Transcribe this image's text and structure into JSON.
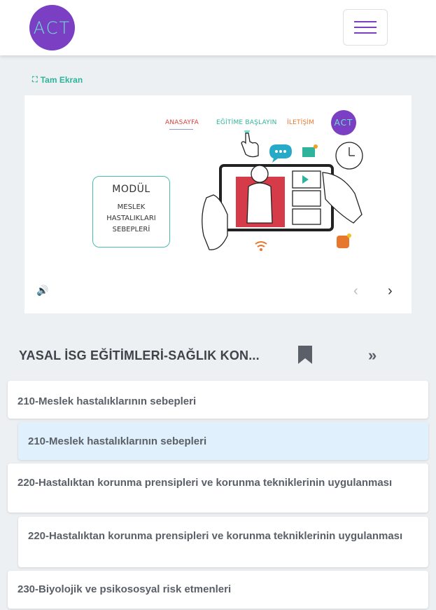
{
  "header": {
    "logo_text": "ACT",
    "menu_icon": "hamburger-icon",
    "brand_color": "#7b3fc4",
    "accent_color": "#6ee0d0"
  },
  "player": {
    "fullscreen_label": "Tam Ekran",
    "slide_nav": {
      "home": "ANASAYFA",
      "start": "EĞİTİME BAŞLAYIN",
      "contact": "İLETİŞİM",
      "logo_text": "ACT"
    },
    "module": {
      "title": "MODÜL",
      "line1": "MESLEK",
      "line2": "HASTALIKLARI",
      "line3": "SEBEPLERİ"
    },
    "controls": {
      "volume_icon": "volume-icon",
      "prev_icon": "chevron-left-icon",
      "next_icon": "chevron-right-icon",
      "prev": "‹",
      "next": "›"
    }
  },
  "course": {
    "title": "YASAL İSG EĞİTİMLERİ-SAĞLIK KON...",
    "bookmark_icon": "bookmark-icon",
    "skip_icon": "double-chevron-right-icon",
    "skip": "»"
  },
  "lessons": [
    {
      "label": "210-Meslek hastalıklarının sebepleri",
      "level": "section"
    },
    {
      "label": "210-Meslek hastalıklarının sebepleri",
      "level": "lesson",
      "active": true
    },
    {
      "label": "220-Hastalıktan korunma prensipleri ve korunma tekniklerinin uygulanması",
      "level": "section"
    },
    {
      "label": "220-Hastalıktan korunma prensipleri ve korunma tekniklerinin uygulanması",
      "level": "lesson"
    },
    {
      "label": "230-Biyolojik ve psikososyal risk etmenleri",
      "level": "section"
    }
  ]
}
